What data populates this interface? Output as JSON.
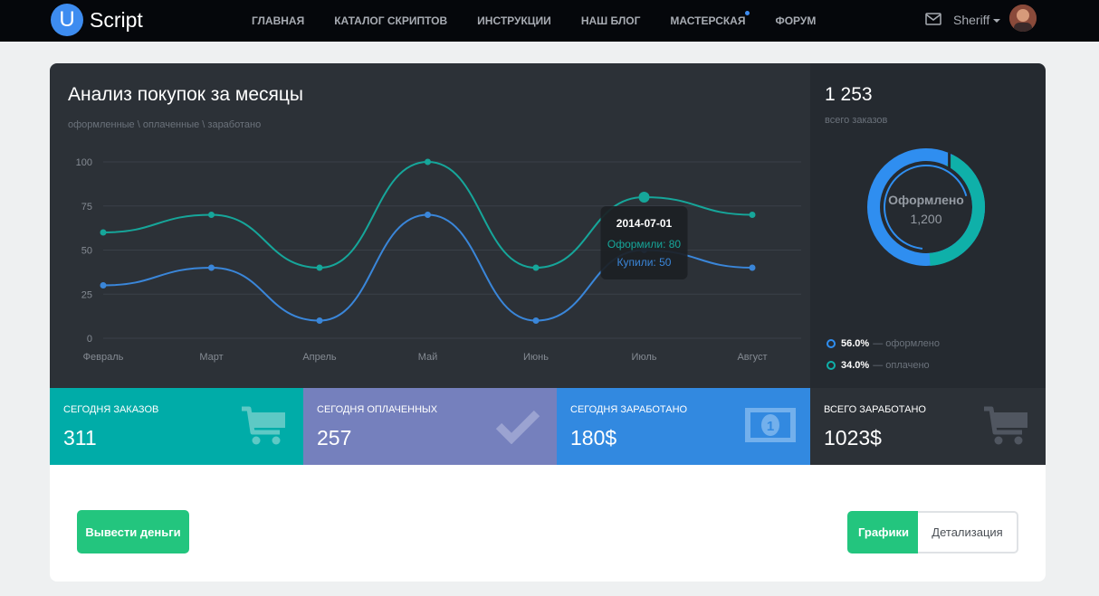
{
  "brand": {
    "logo_letter": "U",
    "name": "Script"
  },
  "nav": {
    "items": [
      {
        "label": "ГЛАВНАЯ"
      },
      {
        "label": "КАТАЛОГ СКРИПТОВ"
      },
      {
        "label": "ИНСТРУКЦИИ"
      },
      {
        "label": "НАШ БЛОГ"
      },
      {
        "label": "МАСТЕРСКАЯ",
        "has_notification": true
      },
      {
        "label": "ФОРУМ"
      }
    ],
    "user_name": "Sheriff"
  },
  "chart_panel": {
    "title": "Анализ покупок за месяцы",
    "subtitle": "оформленные \\ оплаченные \\ заработано",
    "tooltip": {
      "date": "2014-07-01",
      "line1": "Оформили: 80",
      "line2": "Купили: 50"
    }
  },
  "chart_data": {
    "type": "line",
    "categories": [
      "Февраль",
      "Март",
      "Апрель",
      "Май",
      "Июнь",
      "Июль",
      "Август"
    ],
    "y_ticks": [
      "100",
      "75",
      "50",
      "25",
      "0"
    ],
    "ylim": [
      0,
      100
    ],
    "grid": true,
    "series": [
      {
        "name": "Оформили",
        "color": "#16a69a",
        "values": [
          60,
          70,
          40,
          100,
          40,
          80,
          70
        ]
      },
      {
        "name": "Купили",
        "color": "#3a86d9",
        "values": [
          30,
          40,
          10,
          70,
          10,
          50,
          40
        ]
      }
    ],
    "highlight_index": 5
  },
  "side_panel": {
    "total": "1 253",
    "total_label": "всего заказов",
    "donut": {
      "center_title": "Оформлено",
      "center_value": "1,200",
      "outer_color": "#2f8ef0",
      "accent_color": "#0fb0a9"
    },
    "legend": [
      {
        "pct": "56.0%",
        "text": "— оформлено",
        "color": "#2f8ef0"
      },
      {
        "pct": "34.0%",
        "text": "— оплачено",
        "color": "#0fb0a9"
      }
    ]
  },
  "stats": [
    {
      "label": "СЕГОДНЯ ЗАКАЗОВ",
      "value": "311",
      "bg": "#00aca8",
      "icon": "cart-icon"
    },
    {
      "label": "СЕГОДНЯ ОПЛАЧЕННЫХ",
      "value": "257",
      "bg": "#7580bd",
      "icon": "check-icon"
    },
    {
      "label": "СЕГОДНЯ ЗАРАБОТАНО",
      "value": "180$",
      "bg": "#3289e0",
      "icon": "money-icon"
    },
    {
      "label": "ВСЕГО ЗАРАБОТАНО",
      "value": "1023$",
      "bg": "#2c3137",
      "icon": "cart-icon"
    }
  ],
  "actions": {
    "withdraw": "Вывести деньги",
    "charts": "Графики",
    "details": "Детализация"
  }
}
